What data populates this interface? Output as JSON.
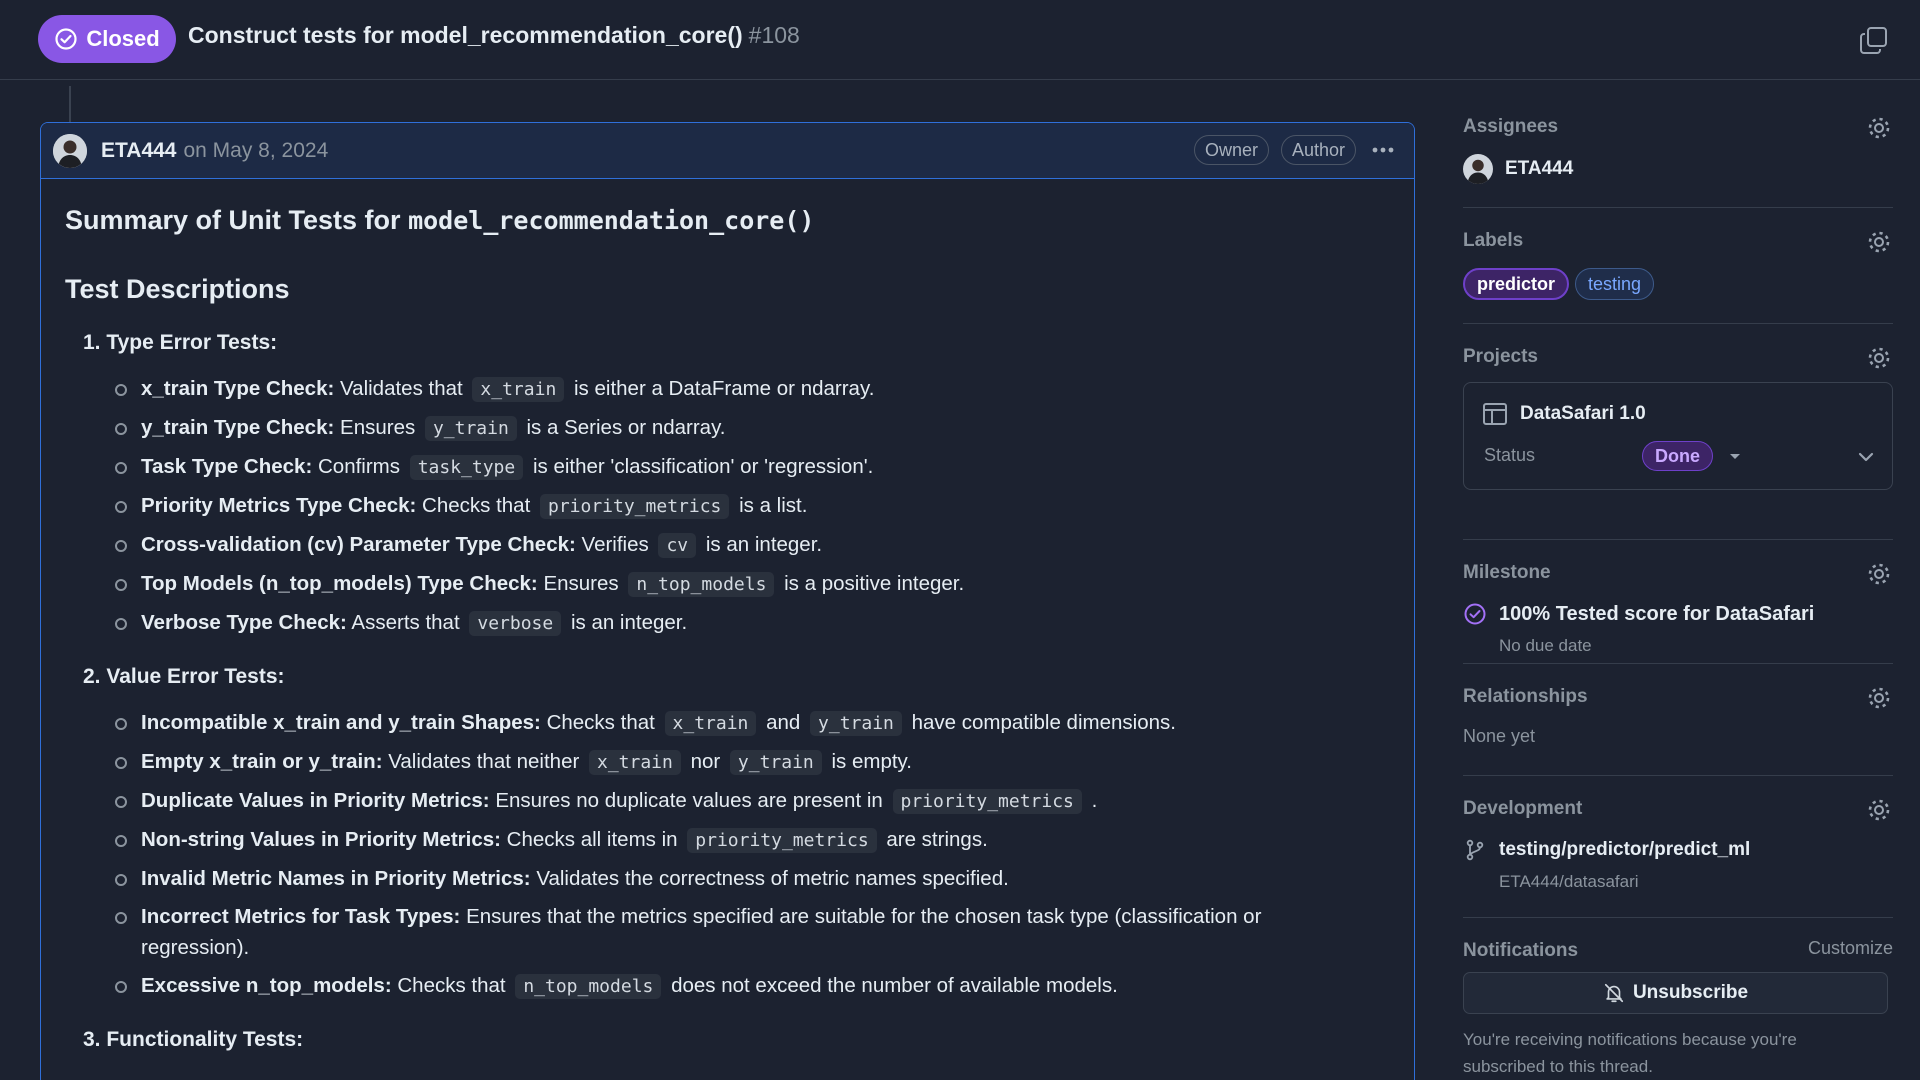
{
  "header": {
    "state": "Closed",
    "title": "Construct tests for model_recommendation_core()",
    "number": "#108"
  },
  "comment": {
    "author": "ETA444",
    "date": "on May 8, 2024",
    "badges": [
      "Owner",
      "Author"
    ],
    "summary_prefix": "Summary of Unit Tests for",
    "summary_code": "model_recommendation_core()",
    "test_descriptions": "Test Descriptions",
    "sections": [
      {
        "title": "1. Type Error Tests:",
        "items": [
          {
            "bold": "x_train Type Check:",
            "parts": [
              "Validates that",
              "x_train",
              "is either a DataFrame or ndarray."
            ]
          },
          {
            "bold": "y_train Type Check:",
            "parts": [
              "Ensures",
              "y_train",
              "is a Series or ndarray."
            ]
          },
          {
            "bold": "Task Type Check:",
            "parts": [
              "Confirms",
              "task_type",
              "is either 'classification' or 'regression'."
            ]
          },
          {
            "bold": "Priority Metrics Type Check:",
            "parts": [
              "Checks that",
              "priority_metrics",
              "is a list."
            ]
          },
          {
            "bold": "Cross-validation (cv) Parameter Type Check:",
            "parts": [
              "Verifies",
              "cv",
              "is an integer."
            ]
          },
          {
            "bold": "Top Models (n_top_models) Type Check:",
            "parts": [
              "Ensures",
              "n_top_models",
              "is a positive integer."
            ]
          },
          {
            "bold": "Verbose Type Check:",
            "parts": [
              "Asserts that",
              "verbose",
              "is an integer."
            ]
          }
        ]
      },
      {
        "title": "2. Value Error Tests:",
        "items": [
          {
            "bold": "Incompatible x_train and y_train Shapes:",
            "parts": [
              "Checks that",
              "x_train",
              "and",
              "y_train",
              "have compatible dimensions."
            ]
          },
          {
            "bold": "Empty x_train or y_train:",
            "parts": [
              "Validates that neither",
              "x_train",
              "nor",
              "y_train",
              "is empty."
            ]
          },
          {
            "bold": "Duplicate Values in Priority Metrics:",
            "parts": [
              "Ensures no duplicate values are present in",
              "priority_metrics",
              "."
            ]
          },
          {
            "bold": "Non-string Values in Priority Metrics:",
            "parts": [
              "Checks all items in",
              "priority_metrics",
              "are strings."
            ]
          },
          {
            "bold": "Invalid Metric Names in Priority Metrics:",
            "parts": [
              "Validates the correctness of metric names specified."
            ]
          },
          {
            "bold": "Incorrect Metrics for Task Types:",
            "parts": [
              "Ensures that the metrics specified are suitable for the chosen task type (classification or regression)."
            ]
          },
          {
            "bold": "Excessive n_top_models:",
            "parts": [
              "Checks that",
              "n_top_models",
              "does not exceed the number of available models."
            ]
          }
        ]
      },
      {
        "title": "3. Functionality Tests:",
        "items": []
      }
    ]
  },
  "sidebar": {
    "assignees": {
      "title": "Assignees",
      "user": "ETA444"
    },
    "labels": {
      "title": "Labels",
      "items": [
        "predictor",
        "testing"
      ]
    },
    "projects": {
      "title": "Projects",
      "name": "DataSafari 1.0",
      "status_label": "Status",
      "status_value": "Done"
    },
    "milestone": {
      "title": "Milestone",
      "name": "100% Tested score for DataSafari",
      "due": "No due date"
    },
    "relationships": {
      "title": "Relationships",
      "value": "None yet"
    },
    "development": {
      "title": "Development",
      "branch": "testing/predictor/predict_ml",
      "repo": "ETA444/datasafari"
    },
    "notifications": {
      "title": "Notifications",
      "customize": "Customize",
      "button": "Unsubscribe",
      "text": "You're receiving notifications because you're subscribed to this thread."
    }
  },
  "colors": {
    "closed": "#8957e5",
    "accent_border": "#2f6fd9",
    "background": "#1c2230"
  }
}
